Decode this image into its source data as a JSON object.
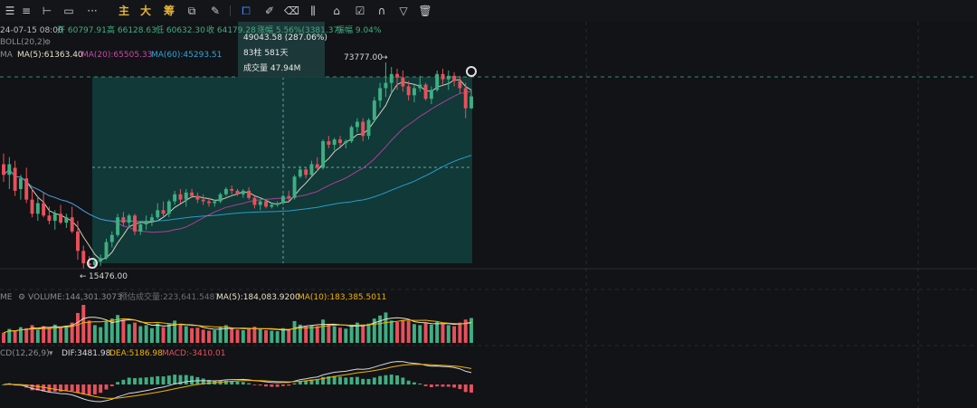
{
  "toolbar": {
    "icons": [
      "menu-icon",
      "lines-icon",
      "horizontal-line-icon",
      "rectangle-icon",
      "more-icon"
    ],
    "main_label": "主",
    "big_label": "大",
    "chip_label": "筹",
    "drawing_icons": [
      "crop-icon",
      "pen-icon",
      "eraser-icon",
      "bars-icon",
      "lock-icon",
      "note-icon",
      "magnet-icon",
      "filter-icon",
      "trash-icon"
    ]
  },
  "ohlc": {
    "date": "24-07-15 08:00",
    "open": "开 60797.91",
    "high": "高 66128.63",
    "low": "低 60632.30",
    "close": "收 64179.28",
    "change": "涨幅 5.56%(3381.37)",
    "amplitude": "振幅 9.04%"
  },
  "boll": "BOLL(20,2)",
  "ma_legend": {
    "label": "MA",
    "ma5": "MA(5):61363.40",
    "ma20": "MA(20):65505.33",
    "ma60": "MA(60):45293.51"
  },
  "measure": {
    "change": "49043.58 (287.06%)",
    "bars": "83柱 581天",
    "volume": "成交量 47.94M"
  },
  "price_labels": {
    "high": "73777.00",
    "low": "15476.00"
  },
  "volume_panel": {
    "label": "ME",
    "volume": "VOLUME:144,301.3073",
    "estimate": "预估成交量:223,641.5487",
    "ma5": "MA(5):184,083.9200",
    "ma10": "MA(10):183,385.5011"
  },
  "macd_panel": {
    "label": "CD(12,26,9)",
    "dif": "DIF:3481.98",
    "dea": "DEA:5186.98",
    "macd": "MACD:-3410.01"
  },
  "colors": {
    "up": "#3fae82",
    "down": "#e8505b",
    "ma5": "#e9e1c8",
    "ma20": "#c040a0",
    "ma60": "#2aa8d8",
    "highlight": "#0f5a56",
    "dif": "#d8d8e0",
    "dea": "#f0b400"
  },
  "chart_data": {
    "type": "candlestick",
    "candles": [
      {
        "o": 45000,
        "h": 48000,
        "l": 40000,
        "c": 42000
      },
      {
        "o": 42000,
        "h": 47000,
        "l": 38000,
        "c": 45000
      },
      {
        "o": 44000,
        "h": 46000,
        "l": 36000,
        "c": 37500
      },
      {
        "o": 38000,
        "h": 42000,
        "l": 35000,
        "c": 41000
      },
      {
        "o": 41000,
        "h": 44000,
        "l": 34000,
        "c": 35000
      },
      {
        "o": 35000,
        "h": 38000,
        "l": 30000,
        "c": 31000
      },
      {
        "o": 31000,
        "h": 36000,
        "l": 29000,
        "c": 34000
      },
      {
        "o": 34000,
        "h": 37000,
        "l": 30000,
        "c": 30500
      },
      {
        "o": 30500,
        "h": 33000,
        "l": 28000,
        "c": 29000
      },
      {
        "o": 29000,
        "h": 32000,
        "l": 26500,
        "c": 31000
      },
      {
        "o": 31000,
        "h": 33500,
        "l": 28000,
        "c": 28500
      },
      {
        "o": 28500,
        "h": 31000,
        "l": 27000,
        "c": 30000
      },
      {
        "o": 30000,
        "h": 33000,
        "l": 25500,
        "c": 26000
      },
      {
        "o": 26000,
        "h": 29000,
        "l": 18000,
        "c": 20500
      },
      {
        "o": 20500,
        "h": 22000,
        "l": 15476,
        "c": 17000
      },
      {
        "o": 17000,
        "h": 19000,
        "l": 15800,
        "c": 16500
      },
      {
        "o": 16500,
        "h": 18000,
        "l": 15900,
        "c": 17500
      },
      {
        "o": 17500,
        "h": 19500,
        "l": 16200,
        "c": 18500
      },
      {
        "o": 18500,
        "h": 24000,
        "l": 18000,
        "c": 23000
      },
      {
        "o": 23000,
        "h": 26000,
        "l": 21500,
        "c": 25000
      },
      {
        "o": 25000,
        "h": 31000,
        "l": 24500,
        "c": 30000
      },
      {
        "o": 30000,
        "h": 31500,
        "l": 27500,
        "c": 28500
      },
      {
        "o": 28500,
        "h": 31000,
        "l": 27000,
        "c": 30500
      },
      {
        "o": 30500,
        "h": 31000,
        "l": 25000,
        "c": 26000
      },
      {
        "o": 26000,
        "h": 29000,
        "l": 25000,
        "c": 28000
      },
      {
        "o": 28000,
        "h": 30500,
        "l": 26500,
        "c": 29000
      },
      {
        "o": 29000,
        "h": 31000,
        "l": 27500,
        "c": 30000
      },
      {
        "o": 30000,
        "h": 34000,
        "l": 29500,
        "c": 32000
      },
      {
        "o": 32000,
        "h": 34500,
        "l": 30000,
        "c": 31000
      },
      {
        "o": 31000,
        "h": 35000,
        "l": 30000,
        "c": 34500
      },
      {
        "o": 34500,
        "h": 37500,
        "l": 33500,
        "c": 36500
      },
      {
        "o": 36500,
        "h": 38000,
        "l": 34000,
        "c": 35000
      },
      {
        "o": 35000,
        "h": 38000,
        "l": 33000,
        "c": 37000
      },
      {
        "o": 37000,
        "h": 38000,
        "l": 35500,
        "c": 36000
      },
      {
        "o": 36000,
        "h": 37000,
        "l": 34000,
        "c": 35000
      },
      {
        "o": 35000,
        "h": 36500,
        "l": 33500,
        "c": 34500
      },
      {
        "o": 34500,
        "h": 35500,
        "l": 33000,
        "c": 34000
      },
      {
        "o": 34000,
        "h": 35000,
        "l": 33000,
        "c": 34500
      },
      {
        "o": 34500,
        "h": 37000,
        "l": 34000,
        "c": 36500
      },
      {
        "o": 36500,
        "h": 38500,
        "l": 36000,
        "c": 38000
      },
      {
        "o": 38000,
        "h": 39000,
        "l": 36500,
        "c": 37500
      },
      {
        "o": 37500,
        "h": 38000,
        "l": 36000,
        "c": 36500
      },
      {
        "o": 36500,
        "h": 38000,
        "l": 35500,
        "c": 37500
      },
      {
        "o": 37500,
        "h": 38500,
        "l": 35000,
        "c": 35500
      },
      {
        "o": 35500,
        "h": 36000,
        "l": 32500,
        "c": 33500
      },
      {
        "o": 33500,
        "h": 35000,
        "l": 32000,
        "c": 34500
      },
      {
        "o": 34500,
        "h": 35000,
        "l": 32500,
        "c": 33000
      },
      {
        "o": 33000,
        "h": 34000,
        "l": 32500,
        "c": 33500
      },
      {
        "o": 33500,
        "h": 34500,
        "l": 33000,
        "c": 34000
      },
      {
        "o": 34000,
        "h": 36500,
        "l": 33500,
        "c": 36000
      },
      {
        "o": 36000,
        "h": 37500,
        "l": 34500,
        "c": 35500
      },
      {
        "o": 35500,
        "h": 42000,
        "l": 35000,
        "c": 41500
      },
      {
        "o": 41500,
        "h": 44500,
        "l": 41000,
        "c": 43500
      },
      {
        "o": 43500,
        "h": 44000,
        "l": 41000,
        "c": 42000
      },
      {
        "o": 42000,
        "h": 46000,
        "l": 41500,
        "c": 45000
      },
      {
        "o": 45000,
        "h": 47000,
        "l": 43000,
        "c": 44000
      },
      {
        "o": 44000,
        "h": 52000,
        "l": 43500,
        "c": 51500
      },
      {
        "o": 51500,
        "h": 53000,
        "l": 49500,
        "c": 50500
      },
      {
        "o": 50500,
        "h": 52500,
        "l": 49000,
        "c": 52000
      },
      {
        "o": 52000,
        "h": 53000,
        "l": 50000,
        "c": 51000
      },
      {
        "o": 51000,
        "h": 52000,
        "l": 49500,
        "c": 51500
      },
      {
        "o": 51500,
        "h": 56000,
        "l": 51000,
        "c": 55500
      },
      {
        "o": 55500,
        "h": 58000,
        "l": 54000,
        "c": 57000
      },
      {
        "o": 57000,
        "h": 58000,
        "l": 51500,
        "c": 53000
      },
      {
        "o": 53000,
        "h": 58000,
        "l": 52000,
        "c": 57500
      },
      {
        "o": 57500,
        "h": 64000,
        "l": 57000,
        "c": 63000
      },
      {
        "o": 63000,
        "h": 68000,
        "l": 61000,
        "c": 66500
      },
      {
        "o": 66500,
        "h": 73777,
        "l": 64000,
        "c": 68000
      },
      {
        "o": 68000,
        "h": 72500,
        "l": 65000,
        "c": 70500
      },
      {
        "o": 70500,
        "h": 72000,
        "l": 66000,
        "c": 69500
      },
      {
        "o": 69500,
        "h": 71500,
        "l": 65500,
        "c": 67000
      },
      {
        "o": 67000,
        "h": 68500,
        "l": 63000,
        "c": 64500
      },
      {
        "o": 64500,
        "h": 67500,
        "l": 62500,
        "c": 66500
      },
      {
        "o": 66500,
        "h": 70000,
        "l": 65500,
        "c": 67500
      },
      {
        "o": 67500,
        "h": 68000,
        "l": 63000,
        "c": 63500
      },
      {
        "o": 63500,
        "h": 67000,
        "l": 62000,
        "c": 66000
      },
      {
        "o": 66000,
        "h": 71500,
        "l": 65500,
        "c": 70500
      },
      {
        "o": 70500,
        "h": 72000,
        "l": 67500,
        "c": 69000
      },
      {
        "o": 69000,
        "h": 71500,
        "l": 66000,
        "c": 70000
      },
      {
        "o": 70000,
        "h": 71000,
        "l": 67000,
        "c": 68500
      },
      {
        "o": 68500,
        "h": 70000,
        "l": 65000,
        "c": 66500
      },
      {
        "o": 66500,
        "h": 68000,
        "l": 58000,
        "c": 60800
      },
      {
        "o": 60800,
        "h": 66128,
        "l": 60632,
        "c": 64179
      }
    ],
    "volumes": [
      40,
      55,
      48,
      62,
      58,
      70,
      52,
      66,
      60,
      72,
      64,
      68,
      80,
      118,
      150,
      88,
      70,
      62,
      84,
      96,
      110,
      92,
      74,
      80,
      66,
      70,
      58,
      76,
      62,
      74,
      88,
      70,
      66,
      58,
      60,
      52,
      48,
      50,
      62,
      70,
      56,
      52,
      50,
      58,
      64,
      54,
      50,
      48,
      46,
      58,
      52,
      86,
      72,
      64,
      70,
      66,
      92,
      74,
      66,
      60,
      56,
      72,
      80,
      70,
      76,
      96,
      108,
      120,
      88,
      82,
      90,
      86,
      74,
      70,
      78,
      72,
      82,
      76,
      70,
      66,
      80,
      92,
      98
    ]
  }
}
